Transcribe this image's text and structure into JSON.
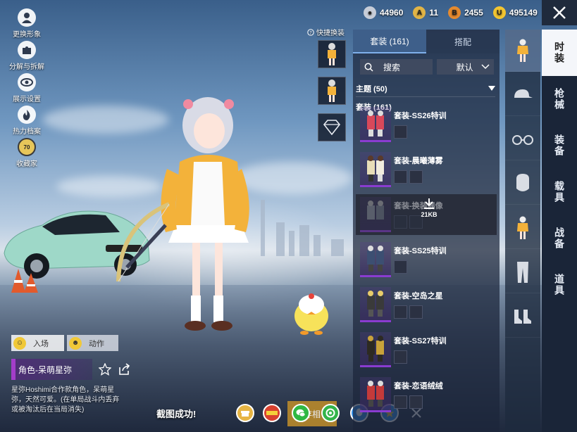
{
  "resources": [
    {
      "icon": "silver-coin-icon",
      "value": "44960",
      "color": "#c7cdd8"
    },
    {
      "icon": "ag-token-icon",
      "value": "11",
      "color": "#e1b446"
    },
    {
      "icon": "bp-coin-icon",
      "value": "2455",
      "color": "#e58a2f"
    },
    {
      "icon": "uc-coin-icon",
      "value": "495149",
      "color": "#f2c531"
    }
  ],
  "left_menu": [
    {
      "icon": "avatar-icon",
      "label": "更换形象"
    },
    {
      "icon": "puzzle-icon",
      "label": "分解与拆解"
    },
    {
      "icon": "eye-icon",
      "label": "展示设置"
    },
    {
      "icon": "flame-icon",
      "label": "热力档案"
    },
    {
      "icon": "collector-badge-icon",
      "label": "收藏家",
      "badge": "70"
    }
  ],
  "quick_change": {
    "label": "快捷换装"
  },
  "anim_tabs": {
    "entry": "入场",
    "action": "动作"
  },
  "character": {
    "name": "角色-呆萌星弥",
    "description": "星弥Hoshimi合作款角色，呆萌星弥，天然可爱。(在单局战斗内丢弃或被淘汰后在当局消失)"
  },
  "share_bar": {
    "toast": "截图成功!",
    "save_label": "存相",
    "buttons": [
      "gift-icon",
      "heping-logo-icon",
      "wechat-icon",
      "moments-icon",
      "qq-icon",
      "qzone-icon",
      "close-icon"
    ]
  },
  "panel": {
    "tabs": [
      {
        "label": "套装 (161)",
        "active": true
      },
      {
        "label": "搭配",
        "active": false
      }
    ],
    "search_label": "搜索",
    "sort_label": "默认",
    "theme_label": "主题 (50)",
    "suit_count_label": "套装 (161)",
    "items": [
      {
        "name": "套装-SS26特训",
        "parts": 1,
        "selected": false
      },
      {
        "name": "套装-晨曦薄雾",
        "parts": 2,
        "selected": false
      },
      {
        "name": "套装-换装偶像",
        "parts": 2,
        "selected": true,
        "download_size": "21KB"
      },
      {
        "name": "套装-SS25特训",
        "parts": 1,
        "selected": false
      },
      {
        "name": "套装-空岛之星",
        "parts": 2,
        "selected": false
      },
      {
        "name": "套装-SS27特训",
        "parts": 1,
        "selected": false
      },
      {
        "name": "套装-恋语绒绒",
        "parts": 2,
        "selected": false
      }
    ]
  },
  "categories": [
    "outfit-icon",
    "cap-icon",
    "glasses-icon",
    "mask-icon",
    "top-icon",
    "pants-icon",
    "boots-icon"
  ],
  "vtabs": [
    {
      "label": "时装",
      "active": true
    },
    {
      "label": "枪械",
      "active": false
    },
    {
      "label": "装备",
      "active": false
    },
    {
      "label": "载具",
      "active": false
    },
    {
      "label": "战备",
      "active": false
    },
    {
      "label": "道具",
      "active": false
    }
  ]
}
